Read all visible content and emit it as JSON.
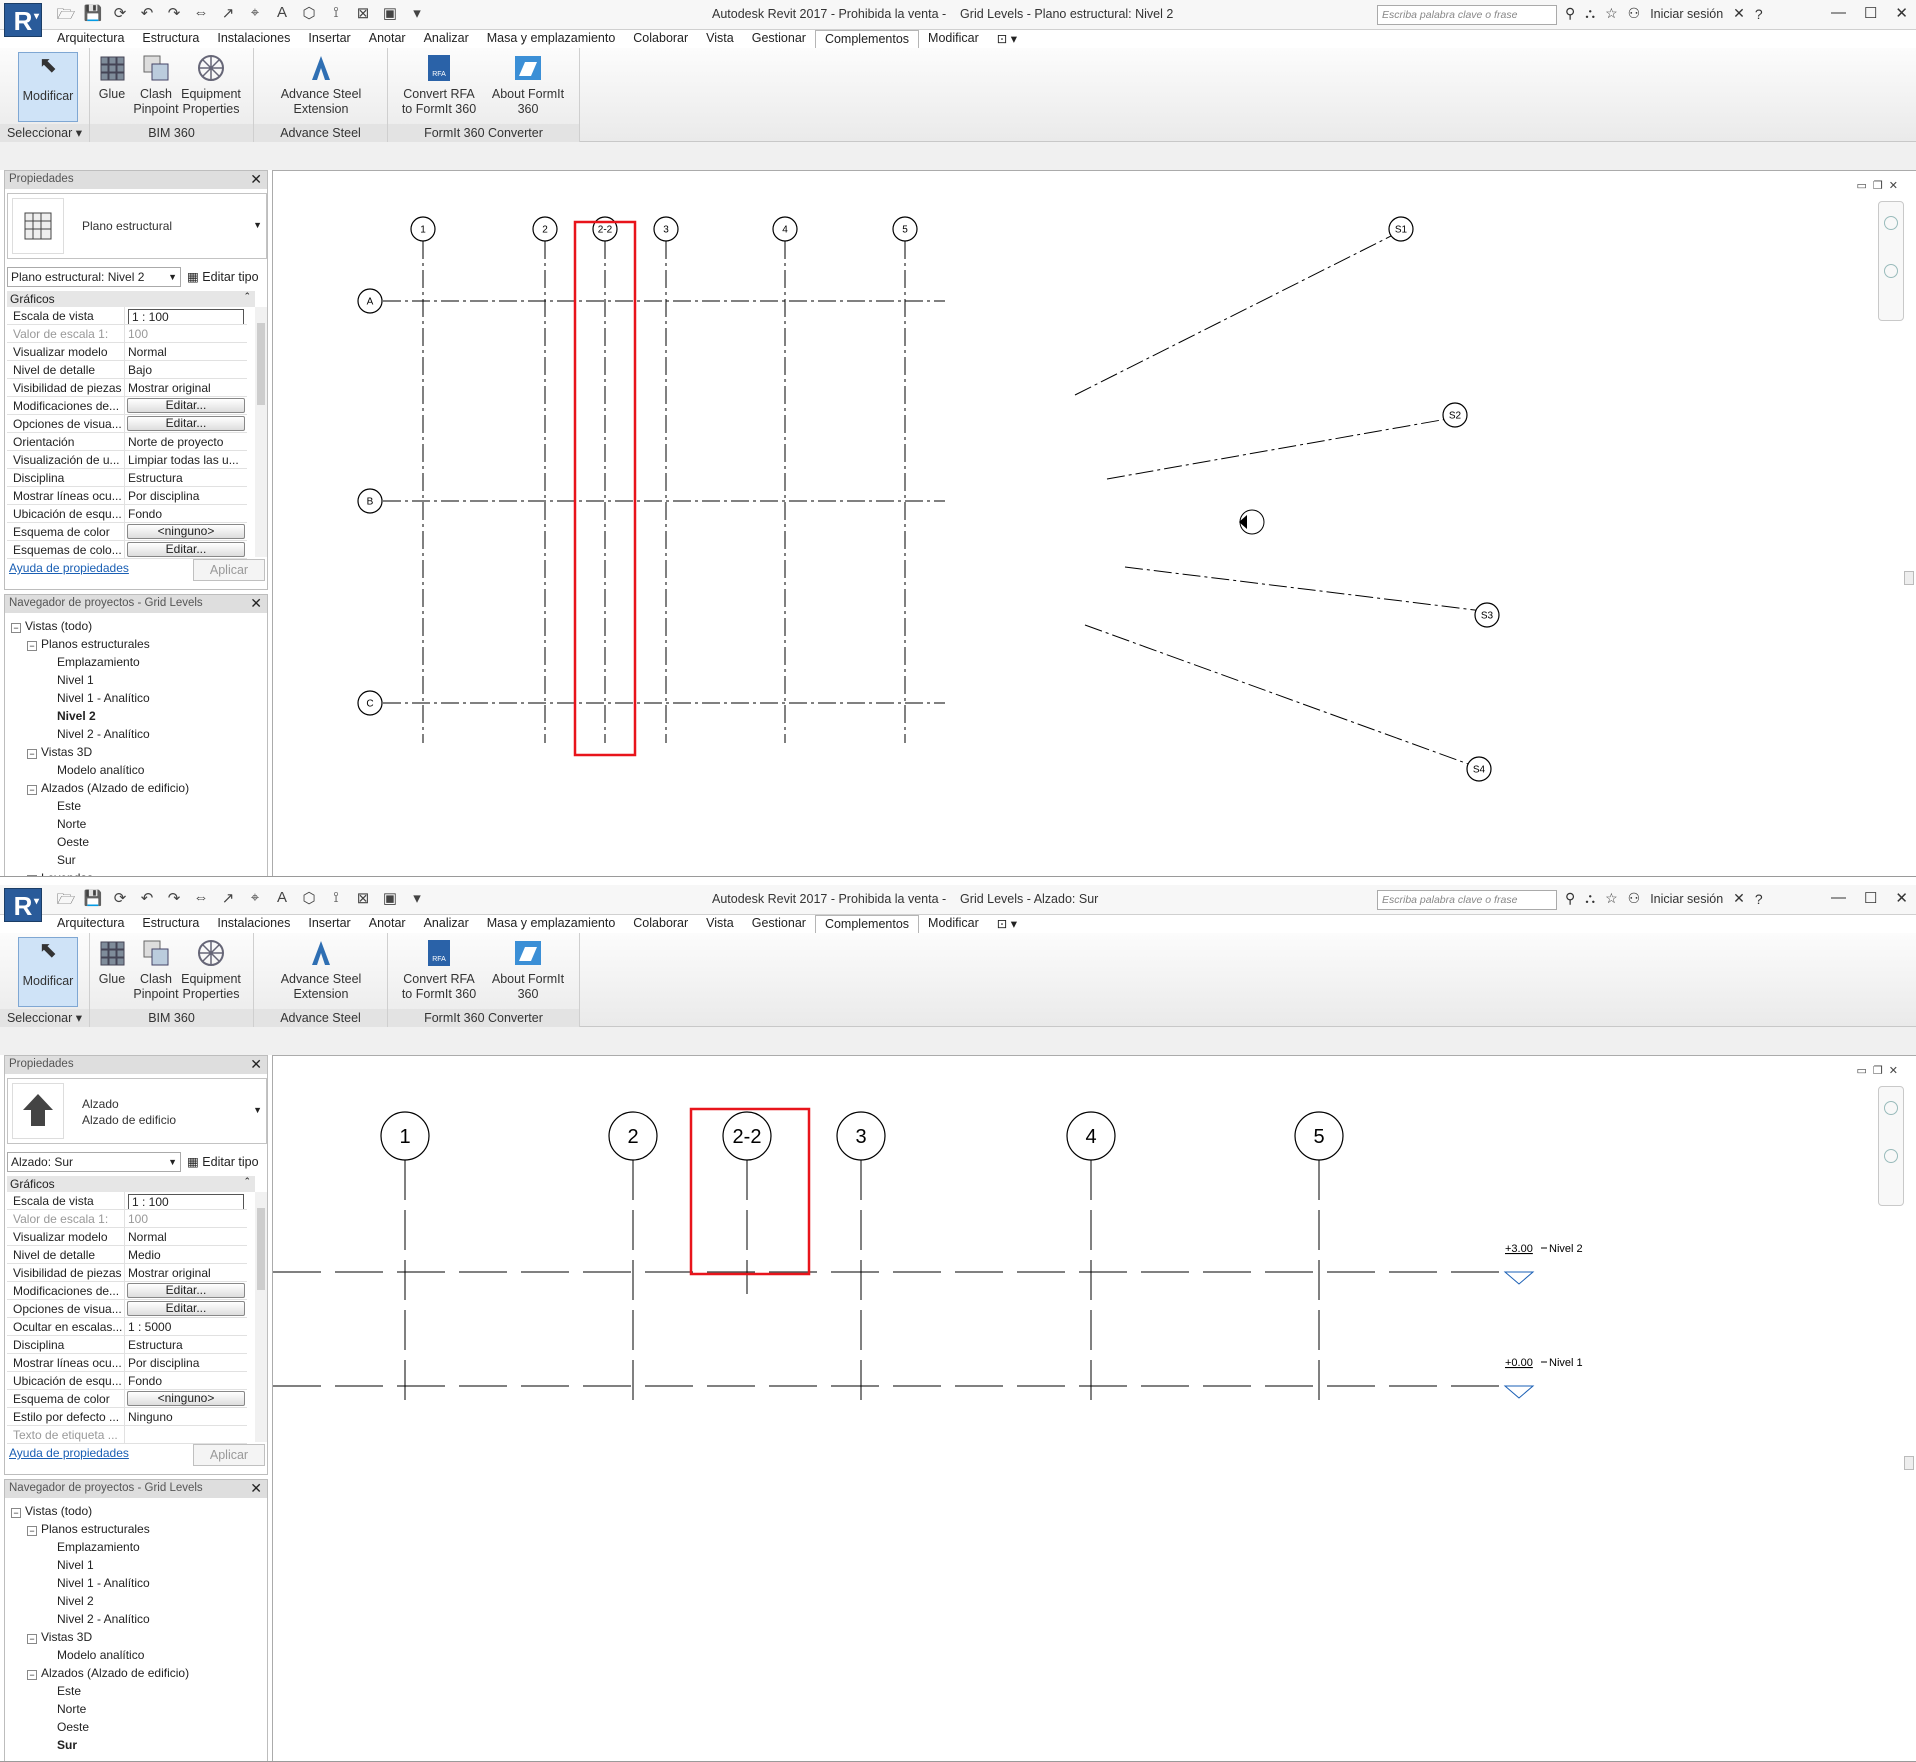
{
  "windows": [
    {
      "title": "Autodesk Revit 2017 - Prohibida la venta -    Grid Levels - Plano estructural: Nivel 2",
      "search_placeholder": "Escriba palabra clave o frase",
      "signin": "Iniciar sesión",
      "tabs": [
        "Arquitectura",
        "Estructura",
        "Instalaciones",
        "Insertar",
        "Anotar",
        "Analizar",
        "Masa y emplazamiento",
        "Colaborar",
        "Vista",
        "Gestionar",
        "Complementos",
        "Modificar"
      ],
      "active_tab": "Complementos",
      "ribbon": {
        "modify": "Modificar",
        "select": "Seleccionar ▾",
        "tools": [
          {
            "label": "Glue"
          },
          {
            "label": "Clash\nPinpoint"
          },
          {
            "label": "Equipment\nProperties"
          },
          {
            "label": "Advance Steel\nExtension"
          },
          {
            "label": "Convert RFA\nto FormIt 360"
          },
          {
            "label": "About FormIt 360"
          }
        ],
        "panels": [
          "BIM 360",
          "Advance Steel Extension",
          "FormIt 360 Converter"
        ]
      },
      "properties": {
        "header": "Propiedades",
        "type_lines": [
          "Plano estructural"
        ],
        "selector": "Plano estructural: Nivel 2",
        "edit_type": "Editar tipo",
        "group": "Gráficos",
        "rows": [
          {
            "k": "Escala de vista",
            "v": "1 : 100",
            "kind": "inp"
          },
          {
            "k": "Valor de escala    1:",
            "v": "100",
            "kind": "dis"
          },
          {
            "k": "Visualizar modelo",
            "v": "Normal"
          },
          {
            "k": "Nivel de detalle",
            "v": "Bajo"
          },
          {
            "k": "Visibilidad de piezas",
            "v": "Mostrar original"
          },
          {
            "k": "Modificaciones de...",
            "v": "Editar...",
            "kind": "btn"
          },
          {
            "k": "Opciones de visua...",
            "v": "Editar...",
            "kind": "btn"
          },
          {
            "k": "Orientación",
            "v": "Norte de proyecto"
          },
          {
            "k": "Visualización de u...",
            "v": "Limpiar todas las u..."
          },
          {
            "k": "Disciplina",
            "v": "Estructura"
          },
          {
            "k": "Mostrar líneas ocu...",
            "v": "Por disciplina"
          },
          {
            "k": "Ubicación de esqu...",
            "v": "Fondo"
          },
          {
            "k": "Esquema de color",
            "v": "<ninguno>",
            "kind": "btn"
          },
          {
            "k": "Esquemas de colo...",
            "v": "Editar...",
            "kind": "btn"
          }
        ],
        "help": "Ayuda de propiedades",
        "apply": "Aplicar"
      },
      "browser": {
        "header": "Navegador de proyectos - Grid Levels",
        "nodes": [
          {
            "t": "Vistas (todo)",
            "d": 0,
            "tg": "−"
          },
          {
            "t": "Planos estructurales",
            "d": 1,
            "tg": "−"
          },
          {
            "t": "Emplazamiento",
            "d": 2
          },
          {
            "t": "Nivel 1",
            "d": 2
          },
          {
            "t": "Nivel 1 - Analítico",
            "d": 2
          },
          {
            "t": "Nivel 2",
            "d": 2,
            "b": true
          },
          {
            "t": "Nivel 2 - Analítico",
            "d": 2
          },
          {
            "t": "Vistas 3D",
            "d": 1,
            "tg": "−"
          },
          {
            "t": "Modelo analítico",
            "d": 2
          },
          {
            "t": "Alzados (Alzado de edificio)",
            "d": 1,
            "tg": "−"
          },
          {
            "t": "Este",
            "d": 2
          },
          {
            "t": "Norte",
            "d": 2
          },
          {
            "t": "Oeste",
            "d": 2
          },
          {
            "t": "Sur",
            "d": 2
          },
          {
            "t": "Leyendas",
            "d": 1,
            "tg": "+"
          }
        ]
      },
      "view": {
        "kind": "plan",
        "vgrids": [
          "1",
          "2",
          "2-2",
          "3",
          "4",
          "5"
        ],
        "hgrids": [
          "A",
          "B",
          "C"
        ],
        "radial": [
          "S1",
          "S2",
          "S3",
          "S4"
        ]
      }
    },
    {
      "title": "Autodesk Revit 2017 - Prohibida la venta -    Grid Levels - Alzado: Sur",
      "search_placeholder": "Escriba palabra clave o frase",
      "signin": "Iniciar sesión",
      "tabs": [
        "Arquitectura",
        "Estructura",
        "Instalaciones",
        "Insertar",
        "Anotar",
        "Analizar",
        "Masa y emplazamiento",
        "Colaborar",
        "Vista",
        "Gestionar",
        "Complementos",
        "Modificar"
      ],
      "active_tab": "Complementos",
      "ribbon": {
        "modify": "Modificar",
        "select": "Seleccionar ▾",
        "tools": [
          {
            "label": "Glue"
          },
          {
            "label": "Clash\nPinpoint"
          },
          {
            "label": "Equipment\nProperties"
          },
          {
            "label": "Advance Steel\nExtension"
          },
          {
            "label": "Convert RFA\nto FormIt 360"
          },
          {
            "label": "About FormIt 360"
          }
        ],
        "panels": [
          "BIM 360",
          "Advance Steel Extension",
          "FormIt 360 Converter"
        ]
      },
      "properties": {
        "header": "Propiedades",
        "type_lines": [
          "Alzado",
          "Alzado de edificio"
        ],
        "selector": "Alzado: Sur",
        "edit_type": "Editar tipo",
        "group": "Gráficos",
        "rows": [
          {
            "k": "Escala de vista",
            "v": "1 : 100",
            "kind": "inp"
          },
          {
            "k": "Valor de escala    1:",
            "v": "100",
            "kind": "dis"
          },
          {
            "k": "Visualizar modelo",
            "v": "Normal"
          },
          {
            "k": "Nivel de detalle",
            "v": "Medio"
          },
          {
            "k": "Visibilidad de piezas",
            "v": "Mostrar original"
          },
          {
            "k": "Modificaciones de...",
            "v": "Editar...",
            "kind": "btn"
          },
          {
            "k": "Opciones de visua...",
            "v": "Editar...",
            "kind": "btn"
          },
          {
            "k": "Ocultar en escalas...",
            "v": "1 : 5000"
          },
          {
            "k": "Disciplina",
            "v": "Estructura"
          },
          {
            "k": "Mostrar líneas ocu...",
            "v": "Por disciplina"
          },
          {
            "k": "Ubicación de esqu...",
            "v": "Fondo"
          },
          {
            "k": "Esquema de color",
            "v": "<ninguno>",
            "kind": "btn"
          },
          {
            "k": "Estilo por defecto ...",
            "v": "Ninguno"
          },
          {
            "k": "Texto de etiqueta ...",
            "v": "",
            "kind": "dis"
          }
        ],
        "help": "Ayuda de propiedades",
        "apply": "Aplicar"
      },
      "browser": {
        "header": "Navegador de proyectos - Grid Levels",
        "nodes": [
          {
            "t": "Vistas (todo)",
            "d": 0,
            "tg": "−"
          },
          {
            "t": "Planos estructurales",
            "d": 1,
            "tg": "−"
          },
          {
            "t": "Emplazamiento",
            "d": 2
          },
          {
            "t": "Nivel 1",
            "d": 2
          },
          {
            "t": "Nivel 1 - Analítico",
            "d": 2
          },
          {
            "t": "Nivel 2",
            "d": 2
          },
          {
            "t": "Nivel 2 - Analítico",
            "d": 2
          },
          {
            "t": "Vistas 3D",
            "d": 1,
            "tg": "−"
          },
          {
            "t": "Modelo analítico",
            "d": 2
          },
          {
            "t": "Alzados (Alzado de edificio)",
            "d": 1,
            "tg": "−"
          },
          {
            "t": "Este",
            "d": 2
          },
          {
            "t": "Norte",
            "d": 2
          },
          {
            "t": "Oeste",
            "d": 2
          },
          {
            "t": "Sur",
            "d": 2,
            "b": true
          }
        ]
      },
      "view": {
        "kind": "elev",
        "vgrids": [
          "1",
          "2",
          "2-2",
          "3",
          "4",
          "5"
        ],
        "levels": [
          {
            "elev": "+3.00",
            "name": "Nivel 2"
          },
          {
            "elev": "+0.00",
            "name": "Nivel 1"
          }
        ]
      }
    }
  ],
  "colors": {
    "highlight": "#e8141b",
    "accent": "#2a5b9a"
  },
  "icons": [
    "revit-logo-icon",
    "glue-icon",
    "clash-icon",
    "equipment-icon",
    "advance-steel-icon",
    "convert-rfa-icon",
    "formit-icon",
    "floor-plan-icon",
    "elevation-icon",
    "edit-type-icon",
    "view-cube-icon"
  ]
}
